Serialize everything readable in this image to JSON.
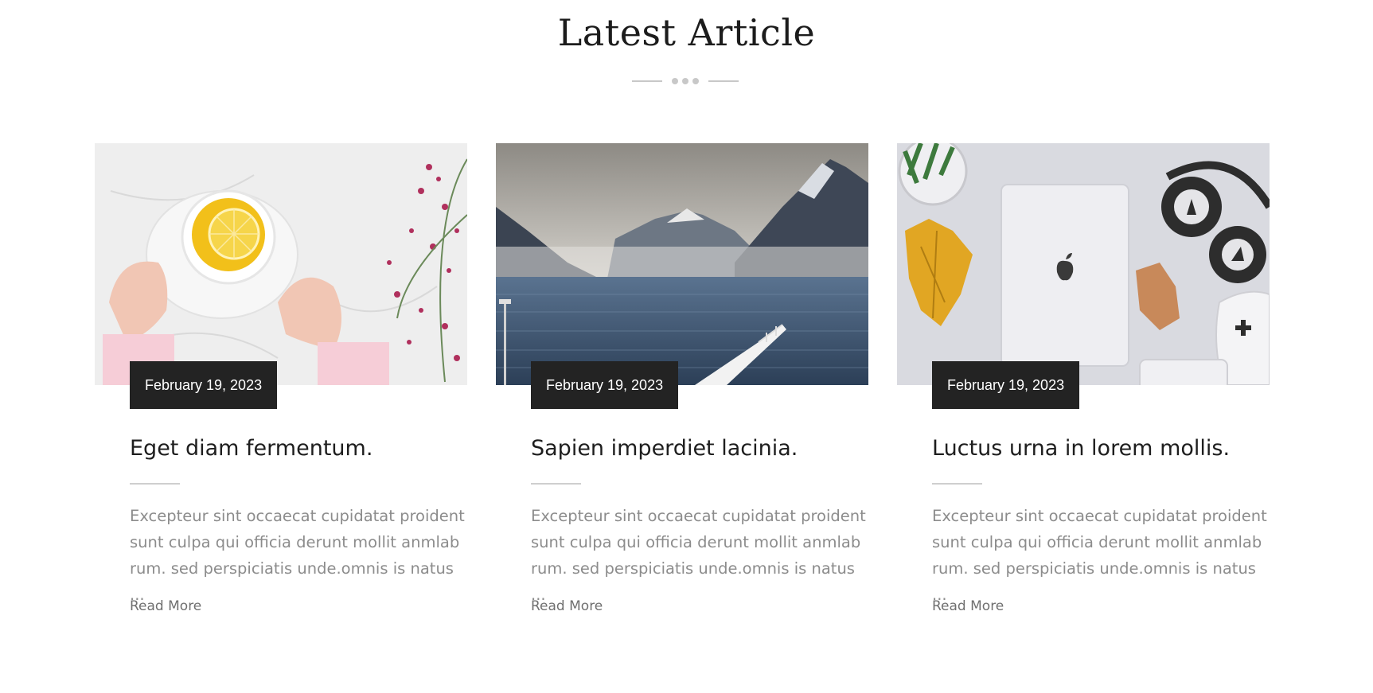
{
  "section": {
    "title": "Latest Article"
  },
  "articles": [
    {
      "date": "February 19, 2023",
      "title": "Eget diam fermentum.",
      "excerpt": "Excepteur sint occaecat cupidatat proident\nsunt culpa qui officia derunt mollit anmlab\nrum. sed perspiciatis unde.omnis is natus ...",
      "read_more": "Read More",
      "image": "tea-cup-with-lemon-photo"
    },
    {
      "date": "February 19, 2023",
      "title": "Sapien imperdiet lacinia.",
      "excerpt": "Excepteur sint occaecat cupidatat proident\nsunt culpa qui officia derunt mollit anmlab\nrum. sed perspiciatis unde.omnis is natus ...",
      "read_more": "Read More",
      "image": "mountain-lake-pier-photo"
    },
    {
      "date": "February 19, 2023",
      "title": "Luctus urna in lorem mollis.",
      "excerpt": "Excepteur sint occaecat cupidatat proident\nsunt culpa qui officia derunt mollit anmlab\nrum. sed perspiciatis unde.omnis is natus ...",
      "read_more": "Read More",
      "image": "laptop-headphones-desk-photo"
    }
  ],
  "colors": {
    "badge_background": "#232323",
    "title_text": "#1e1e1e",
    "excerpt_text": "#8c8c8c",
    "divider": "#c8c8c8"
  }
}
